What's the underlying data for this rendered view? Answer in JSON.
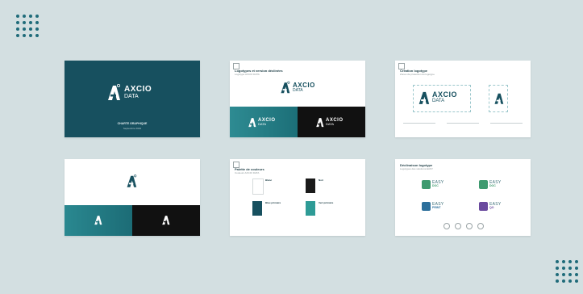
{
  "slides": [
    {
      "id": "cover",
      "brand": "AXCIO",
      "sub": "DATA",
      "caption_1": "CHARTE GRAPHIQUE",
      "caption_2": "Septembre 2023"
    },
    {
      "id": "logo-variants",
      "title": "Logotypes et version déclinées",
      "subtitle": "Logotype AXCIO DATA",
      "brand": "AXCIO",
      "sub": "DATA"
    },
    {
      "id": "construction",
      "title": "Création logotype",
      "subtitle": "Zones de protection du logotype",
      "brand": "AXCIO",
      "sub": "DATA"
    },
    {
      "id": "symbol-variants"
    },
    {
      "id": "palette",
      "title": "Palette de couleurs",
      "subtitle": "Couleurs AXCIO DATA",
      "swatches": [
        {
          "name": "Blanc",
          "color": "#ffffff"
        },
        {
          "name": "Noir",
          "color": "#1a1a1a"
        },
        {
          "name": "Bleu primaire",
          "color": "#17505f"
        },
        {
          "name": "Vert primaire",
          "color": "#2e9b96"
        }
      ]
    },
    {
      "id": "apps",
      "title": "Déclinaison logotype",
      "subtitle": "Logotypes des solutions EASY",
      "apps": [
        {
          "name": "EASY",
          "tag": "DOC",
          "color": "#3e9a6f"
        },
        {
          "name": "EASY",
          "tag": "DOC",
          "color": "#3e9a6f"
        },
        {
          "name": "EASY",
          "tag": "PRINT",
          "color": "#2c6f9b"
        },
        {
          "name": "EASY",
          "tag": "QO",
          "color": "#6a4a9e"
        }
      ]
    }
  ],
  "colors": {
    "background": "#d3dfe1",
    "primary": "#17505f",
    "teal": "#2e8b92",
    "dots": "#1f6b7a"
  }
}
